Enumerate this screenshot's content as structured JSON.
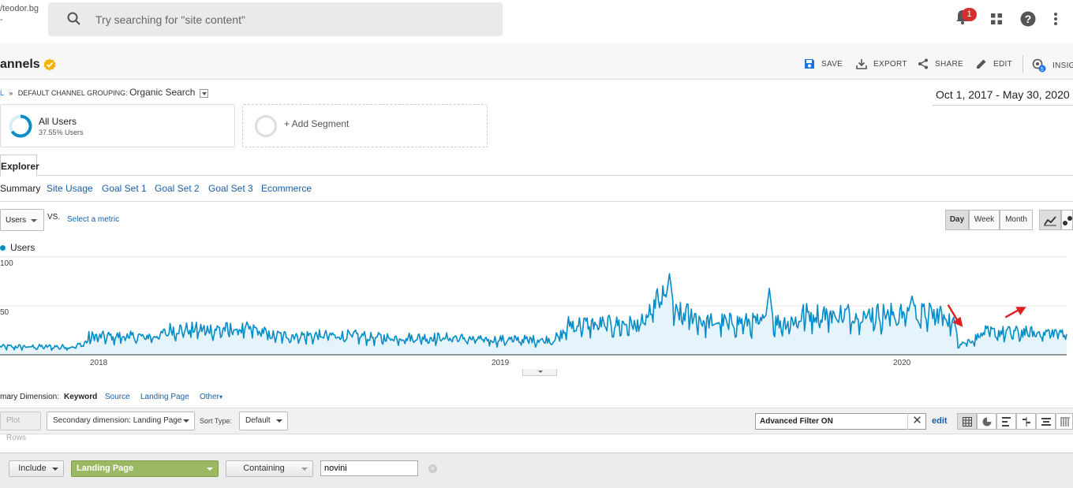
{
  "topbar": {
    "account_text": "/teodor.bg",
    "account_sub": "-",
    "search_placeholder": "Try searching for \"site content\"",
    "notification_count": "1"
  },
  "header": {
    "title": "annels",
    "actions": [
      {
        "label": "SAVE",
        "icon": "save-icon"
      },
      {
        "label": "EXPORT",
        "icon": "export-icon"
      },
      {
        "label": "SHARE",
        "icon": "share-icon"
      },
      {
        "label": "EDIT",
        "icon": "pencil-icon"
      },
      {
        "label": "INSIGH",
        "icon": "insights-icon"
      }
    ]
  },
  "breadcrumb": {
    "prefix": "L",
    "sep": "»",
    "label": "DEFAULT CHANNEL GROUPING:",
    "value": "Organic Search"
  },
  "date_range": "Oct 1, 2017 - May 30, 2020",
  "segments": {
    "all_users": {
      "name": "All Users",
      "sub": "37.55% Users"
    },
    "add": {
      "label": "+ Add Segment"
    }
  },
  "tabs": {
    "active": "Explorer"
  },
  "subtabs": [
    "Summary",
    "Site Usage",
    "Goal Set 1",
    "Goal Set 2",
    "Goal Set 3",
    "Ecommerce"
  ],
  "metric_controls": {
    "metric": "Users",
    "vs": "VS.",
    "select_metric": "Select a metric",
    "granularity": [
      "Day",
      "Week",
      "Month"
    ],
    "granularity_selected": "Day"
  },
  "chart_data": {
    "type": "area",
    "series": [
      {
        "name": "Users"
      }
    ],
    "y_ticks": [
      "100",
      "50"
    ],
    "x_ticks": [
      "2018",
      "2019",
      "2020"
    ],
    "x_range": [
      "2017-10-01",
      "2020-05-30"
    ],
    "ylim": [
      0,
      100
    ],
    "baseline_segments": [
      {
        "start": "2017-10-01",
        "end": "2017-12-20",
        "value": 8
      },
      {
        "start": "2017-12-20",
        "end": "2018-03-01",
        "value": 18
      },
      {
        "start": "2018-03-01",
        "end": "2018-06-01",
        "value": 25
      },
      {
        "start": "2018-06-01",
        "end": "2018-09-01",
        "value": 19
      },
      {
        "start": "2018-09-01",
        "end": "2018-12-01",
        "value": 17
      },
      {
        "start": "2018-12-01",
        "end": "2019-03-01",
        "value": 15
      },
      {
        "start": "2019-03-01",
        "end": "2019-05-20",
        "value": 30
      },
      {
        "start": "2019-05-20",
        "end": "2019-06-06",
        "value": 55
      },
      {
        "start": "2019-06-06",
        "end": "2019-07-01",
        "value": 40
      },
      {
        "start": "2019-07-01",
        "end": "2019-10-01",
        "value": 32
      },
      {
        "start": "2019-10-01",
        "end": "2020-02-20",
        "value": 40
      },
      {
        "start": "2020-02-20",
        "end": "2020-03-10",
        "value": 12
      },
      {
        "start": "2020-03-10",
        "end": "2020-05-30",
        "value": 22
      }
    ],
    "spikes": [
      {
        "date": "2019-06-03",
        "value": 83
      },
      {
        "date": "2019-09-02",
        "value": 68
      },
      {
        "date": "2020-01-10",
        "value": 60
      }
    ],
    "annotations": [
      {
        "type": "arrow",
        "direction": "down",
        "date": "2020-02-22",
        "value": 30
      },
      {
        "type": "arrow",
        "direction": "up",
        "date": "2020-04-20",
        "value": 48
      }
    ]
  },
  "primary_dimension": {
    "label": "mary Dimension:",
    "items": [
      "Keyword",
      "Source",
      "Landing Page",
      "Other"
    ],
    "selected": "Keyword"
  },
  "table_toolbar": {
    "plot_rows": "Plot Rows",
    "secondary": "Secondary dimension: Landing Page",
    "sort_label": "Sort Type:",
    "sort_value": "Default",
    "advanced_filter": "Advanced Filter ON",
    "edit": "edit"
  },
  "filter": {
    "include": "Include",
    "dimension": "Landing Page",
    "match": "Containing",
    "value": "novini"
  },
  "colors": {
    "series": "#058dc7",
    "fill": "#e5f3fb",
    "arrow": "#e02020",
    "filter_green": "#9bb862"
  }
}
